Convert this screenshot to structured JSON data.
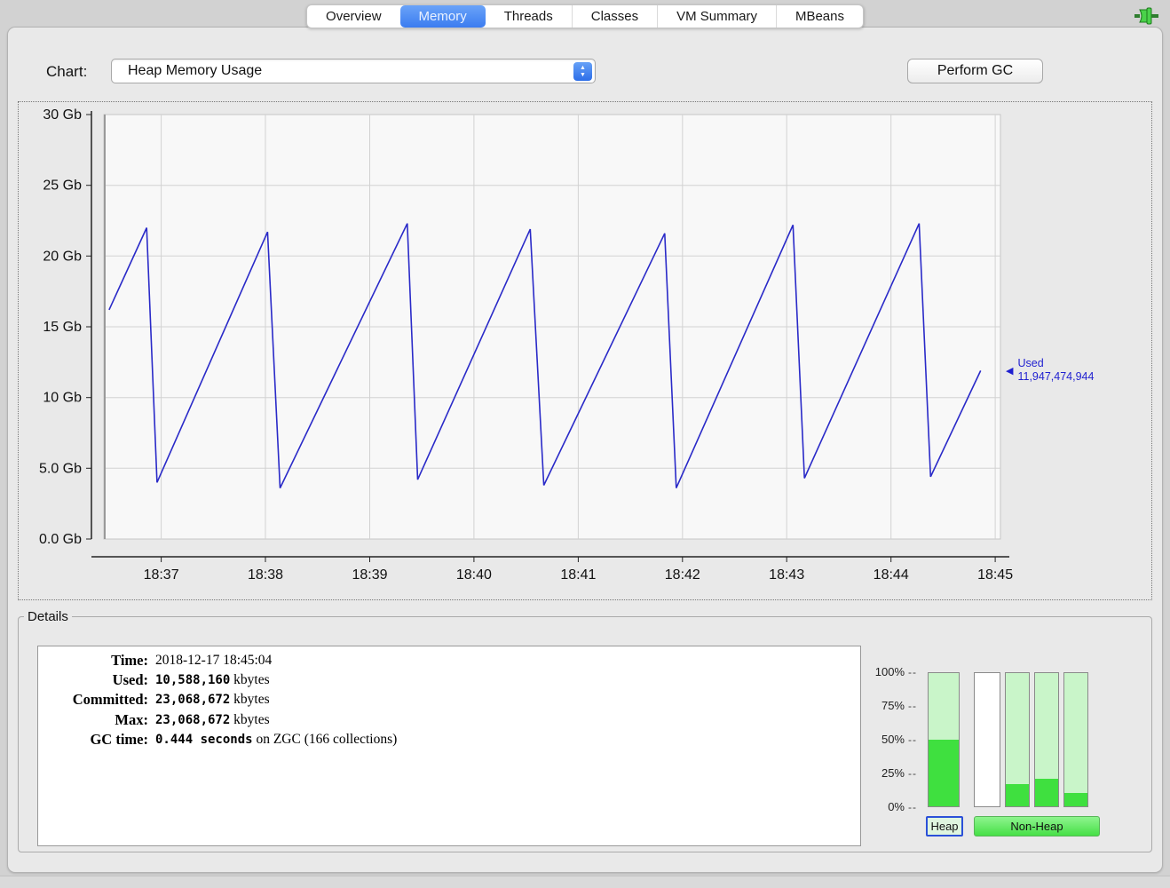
{
  "tabs": [
    {
      "label": "Overview",
      "selected": false
    },
    {
      "label": "Memory",
      "selected": true
    },
    {
      "label": "Threads",
      "selected": false
    },
    {
      "label": "Classes",
      "selected": false
    },
    {
      "label": "VM Summary",
      "selected": false
    },
    {
      "label": "MBeans",
      "selected": false
    }
  ],
  "toolbar": {
    "chart_label": "Chart:",
    "chart_value": "Heap Memory Usage",
    "perform_gc": "Perform GC"
  },
  "used_indicator": {
    "label": "Used",
    "value": "11,947,474,944",
    "gb": 11.9,
    "color": "#1f1fd0"
  },
  "chart_data": {
    "type": "line",
    "title": "Heap Memory Usage",
    "x_unit": "time (minutes after 18:00)",
    "xlim": [
      36.45,
      45.05
    ],
    "ylim": [
      0,
      30
    ],
    "grid": true,
    "x_ticks": [
      {
        "value": 37,
        "label": "18:37"
      },
      {
        "value": 38,
        "label": "18:38"
      },
      {
        "value": 39,
        "label": "18:39"
      },
      {
        "value": 40,
        "label": "18:40"
      },
      {
        "value": 41,
        "label": "18:41"
      },
      {
        "value": 42,
        "label": "18:42"
      },
      {
        "value": 43,
        "label": "18:43"
      },
      {
        "value": 44,
        "label": "18:44"
      },
      {
        "value": 45,
        "label": "18:45"
      }
    ],
    "y_ticks": [
      {
        "value": 30,
        "label": "30 Gb"
      },
      {
        "value": 25,
        "label": "25 Gb"
      },
      {
        "value": 20,
        "label": "20 Gb"
      },
      {
        "value": 15,
        "label": "15 Gb"
      },
      {
        "value": 10,
        "label": "10 Gb"
      },
      {
        "value": 5,
        "label": "5.0 Gb"
      },
      {
        "value": 0,
        "label": "0.0 Gb"
      }
    ],
    "series": [
      {
        "name": "Used heap (Gb)",
        "color": "#2a2ac8",
        "points": [
          [
            36.5,
            16.2
          ],
          [
            36.86,
            22.0
          ],
          [
            36.96,
            4.0
          ],
          [
            38.02,
            21.7
          ],
          [
            38.14,
            3.6
          ],
          [
            39.36,
            22.3
          ],
          [
            39.46,
            4.2
          ],
          [
            40.54,
            21.9
          ],
          [
            40.67,
            3.8
          ],
          [
            41.83,
            21.6
          ],
          [
            41.94,
            3.6
          ],
          [
            43.06,
            22.2
          ],
          [
            43.17,
            4.3
          ],
          [
            44.27,
            22.3
          ],
          [
            44.38,
            4.4
          ],
          [
            44.86,
            11.9
          ]
        ]
      }
    ]
  },
  "details": {
    "title": "Details",
    "rows": [
      {
        "label": "Time:",
        "value": "2018-12-17 18:45:04",
        "font": "serif",
        "suffix": ""
      },
      {
        "label": "Used:",
        "value": "10,588,160",
        "font": "mono",
        "suffix": " kbytes"
      },
      {
        "label": "Committed:",
        "value": "23,068,672",
        "font": "mono",
        "suffix": " kbytes"
      },
      {
        "label": "Max:",
        "value": "23,068,672",
        "font": "mono",
        "suffix": " kbytes"
      },
      {
        "label": "GC time:",
        "value": "0.444 seconds",
        "font": "mono",
        "suffix": " on ZGC (166 collections)"
      }
    ]
  },
  "pool_bars": {
    "type": "bar",
    "axis_ticks": [
      {
        "value": 100,
        "label": "100%"
      },
      {
        "value": 75,
        "label": "75%"
      },
      {
        "value": 50,
        "label": "50%"
      },
      {
        "value": 25,
        "label": "25%"
      },
      {
        "value": 0,
        "label": "0%"
      }
    ],
    "bars": [
      {
        "name": "heap",
        "percent": 50,
        "style": "green"
      },
      {
        "name": "pool-2",
        "percent": 0,
        "style": "white"
      },
      {
        "name": "pool-3",
        "percent": 17,
        "style": "green"
      },
      {
        "name": "pool-4",
        "percent": 21,
        "style": "green"
      },
      {
        "name": "pool-5",
        "percent": 10,
        "style": "green"
      }
    ],
    "buttons": {
      "heap": "Heap",
      "non_heap": "Non-Heap"
    },
    "colors": {
      "fill": "#3fe03f",
      "track": "#c9f5c9"
    }
  }
}
